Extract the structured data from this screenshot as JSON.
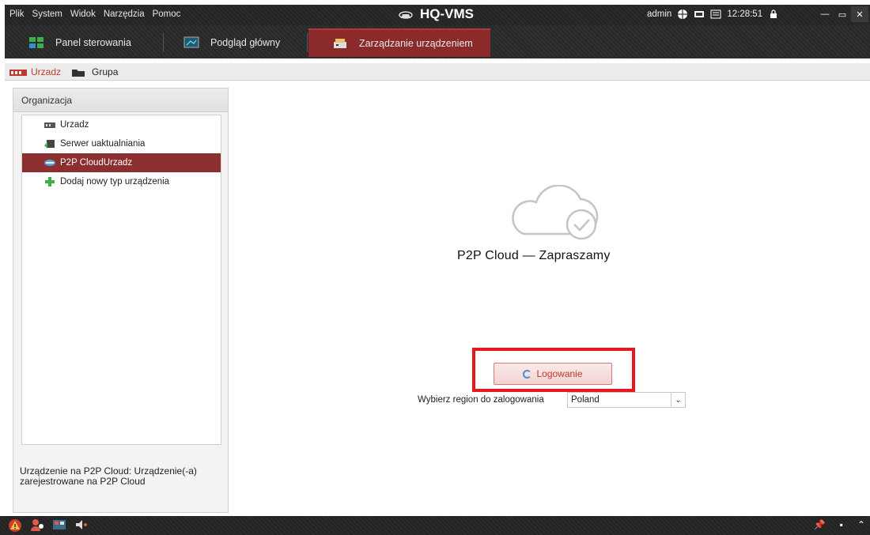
{
  "menubar": {
    "menu_items": [
      "Plik",
      "System",
      "Widok",
      "Narzędzia",
      "Pomoc"
    ],
    "app_title": "HQ-VMS",
    "user": "admin",
    "time": "12:28:51",
    "status_icons": [
      "network-icon",
      "cpu-icon",
      "ram-icon",
      "lock-icon"
    ],
    "window_buttons": [
      "minimize",
      "maximize",
      "close"
    ]
  },
  "tabs": [
    {
      "label": "Panel sterowania",
      "icon": "dashboard-icon",
      "active": false
    },
    {
      "label": "Podgląd główny",
      "icon": "live-view-icon",
      "active": false
    },
    {
      "label": "Zarządzanie urządzeniem",
      "icon": "device-management-icon",
      "active": true
    }
  ],
  "subtabs": [
    {
      "label": "Urzadz",
      "active": true
    },
    {
      "label": "Grupa",
      "active": false
    }
  ],
  "left_panel": {
    "header": "Organizacja",
    "items": [
      {
        "label": "Urzadz",
        "icon": "device-icon",
        "selected": false
      },
      {
        "label": "Serwer uaktualniania",
        "icon": "upgrade-server-icon",
        "selected": false
      },
      {
        "label": "P2P CloudUrzadz",
        "icon": "cloud-device-icon",
        "selected": true
      },
      {
        "label": "Dodaj nowy typ urządzenia",
        "icon": "add-icon",
        "selected": false
      }
    ],
    "description": "Urządzenie na P2P Cloud: Urządzenie(-a) zarejestrowane na P2P Cloud"
  },
  "main": {
    "welcome": "P2P Cloud — Zapraszamy",
    "login_label": "Logowanie",
    "region_label": "Wybierz region do zalogowania",
    "region_value": "Poland"
  },
  "colors": {
    "accent": "#8a2a2a",
    "highlight": "#e8171b",
    "login_text": "#c0392b"
  }
}
